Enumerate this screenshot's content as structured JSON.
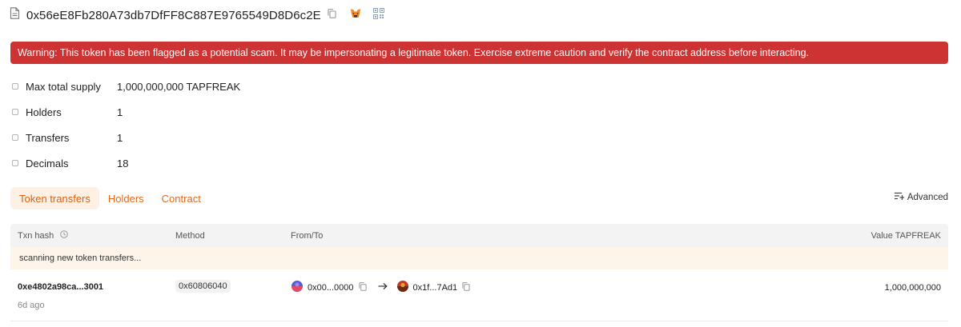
{
  "header": {
    "address": "0x56eE8Fb280A73db7DfFF8C887E9765549D8D6c2E",
    "copy_icon": "copy-icon",
    "wallet_icon": "metamask-fox-icon",
    "qr_icon": "qr-code-icon"
  },
  "warning": {
    "text": "Warning: This token has been flagged as a potential scam. It may be impersonating a legitimate token. Exercise extreme caution and verify the contract address before interacting.",
    "color": "#cd3333"
  },
  "details": [
    {
      "label": "Max total supply",
      "value": "1,000,000,000 TAPFREAK"
    },
    {
      "label": "Holders",
      "value": "1"
    },
    {
      "label": "Transfers",
      "value": "1"
    },
    {
      "label": "Decimals",
      "value": "18"
    }
  ],
  "tabs": [
    {
      "label": "Token transfers",
      "active": true
    },
    {
      "label": "Holders",
      "active": false
    },
    {
      "label": "Contract",
      "active": false
    }
  ],
  "advanced_label": "Advanced",
  "table": {
    "columns": {
      "txn_hash": "Txn hash",
      "method": "Method",
      "from_to": "From/To",
      "value": "Value TAPFREAK"
    },
    "scanning_text": "scanning new token transfers...",
    "rows": [
      {
        "txn_hash": "0xe4802a98ca...3001",
        "age": "6d ago",
        "method": "0x60806040",
        "from": "0x00...0000",
        "to": "0x1f...7Ad1",
        "value": "1,000,000,000"
      }
    ]
  },
  "colors": {
    "accent": "#e0600f",
    "warning_bg": "#cd3333",
    "active_tab_bg": "#fdf1e6",
    "scan_bg": "#fdf5ea"
  }
}
